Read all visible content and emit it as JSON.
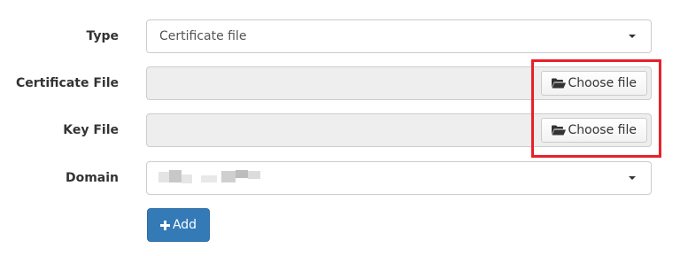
{
  "type": {
    "label": "Type",
    "selected_value": "Certificate file"
  },
  "certificate_file": {
    "label": "Certificate File",
    "button_label": "Choose file"
  },
  "key_file": {
    "label": "Key File",
    "button_label": "Choose file"
  },
  "domain": {
    "label": "Domain",
    "selected_value": ""
  },
  "actions": {
    "add_label": "Add"
  },
  "colors": {
    "primary": "#337ab7",
    "highlight": "#e8202a",
    "disabled_input_bg": "#eeeeee"
  },
  "icons": {
    "dropdown": "caret-down-icon",
    "file_button": "folder-open-icon",
    "add_button": "plus-icon"
  }
}
